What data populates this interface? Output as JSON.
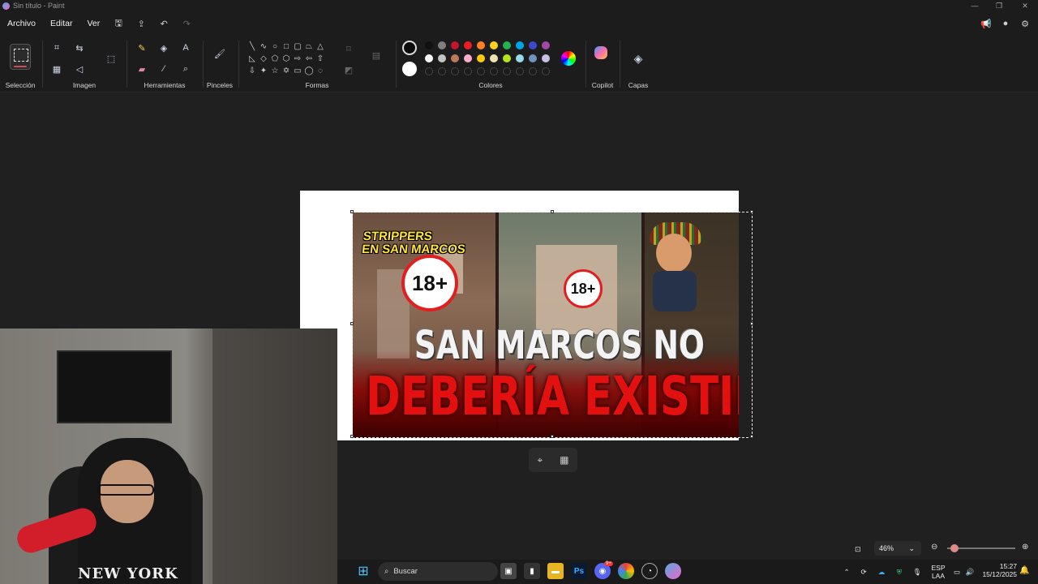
{
  "window": {
    "title": "Sin título - Paint",
    "minimize": "—",
    "maximize": "❐",
    "close": "✕"
  },
  "menu": {
    "archivo": "Archivo",
    "editar": "Editar",
    "ver": "Ver"
  },
  "ribbon": {
    "seleccion": "Selección",
    "imagen": "Imagen",
    "herramientas": "Herramientas",
    "pinceles": "Pinceles",
    "formas": "Formas",
    "colores": "Colores",
    "copilot": "Copilot",
    "capas": "Capas"
  },
  "colors": {
    "primary": "#0b0b0b",
    "secondary": "#ffffff",
    "row1": [
      "#111111",
      "#7f7f7f",
      "#c3152b",
      "#ed1c24",
      "#ff7f27",
      "#ffd21f",
      "#22b14c",
      "#00a2e8",
      "#3f48cc",
      "#a349a4"
    ],
    "row2": [
      "#ffffff",
      "#c3c3c3",
      "#b97a57",
      "#ffaec9",
      "#ffc90e",
      "#efe4b0",
      "#b5e61d",
      "#99d9ea",
      "#7092be",
      "#c8bfe7"
    ]
  },
  "thumbnail": {
    "strippers": "STRIPPERS",
    "en_san_marcos": "EN SAN MARCOS",
    "badge1": "18+",
    "badge2": "18+",
    "line1": "SAN MARCOS NO",
    "line2": "DEBERÍA EXISTIR"
  },
  "webcam": {
    "shirt_text": "NEW YORK"
  },
  "status": {
    "zoom": "46%"
  },
  "taskbar": {
    "search_placeholder": "Buscar",
    "lang_top": "ESP",
    "lang_bottom": "LAA",
    "time": "15:27",
    "date": "15/12/2025",
    "discord_badge": "9+"
  }
}
